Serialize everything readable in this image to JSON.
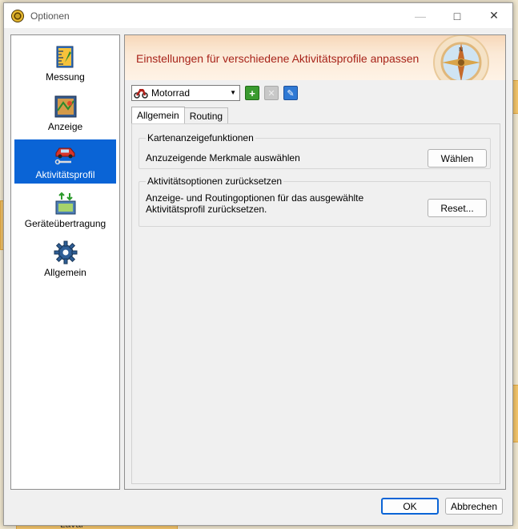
{
  "window": {
    "title": "Optionen"
  },
  "sidebar": {
    "items": [
      {
        "label": "Messung",
        "icon": "ruler-icon"
      },
      {
        "label": "Anzeige",
        "icon": "map-display-icon"
      },
      {
        "label": "Aktivitätsprofil",
        "icon": "car-wrench-icon",
        "selected": true
      },
      {
        "label": "Geräteübertragung",
        "icon": "device-transfer-icon"
      },
      {
        "label": "Allgemein",
        "icon": "gear-icon"
      }
    ]
  },
  "banner": {
    "title": "Einstellungen für verschiedene Aktivitätsprofile anpassen"
  },
  "profile": {
    "selected": "Motorrad"
  },
  "tabs": [
    {
      "label": "Allgemein",
      "active": true
    },
    {
      "label": "Routing",
      "active": false
    }
  ],
  "groups": {
    "map_features": {
      "title": "Kartenanzeigefunktionen",
      "description": "Anzuzeigende Merkmale auswählen",
      "button": "Wählen"
    },
    "reset": {
      "title": "Aktivitätsoptionen zurücksetzen",
      "description_line1": "Anzeige- und Routingoptionen für das ausgewählte",
      "description_line2": "Aktivitätsprofil zurücksetzen.",
      "button": "Reset..."
    }
  },
  "footer": {
    "ok": "OK",
    "cancel": "Abbrechen"
  },
  "background": {
    "texts": [
      "Laval"
    ]
  },
  "colors": {
    "accent": "#0a64d6",
    "banner_title": "#a8241a"
  }
}
